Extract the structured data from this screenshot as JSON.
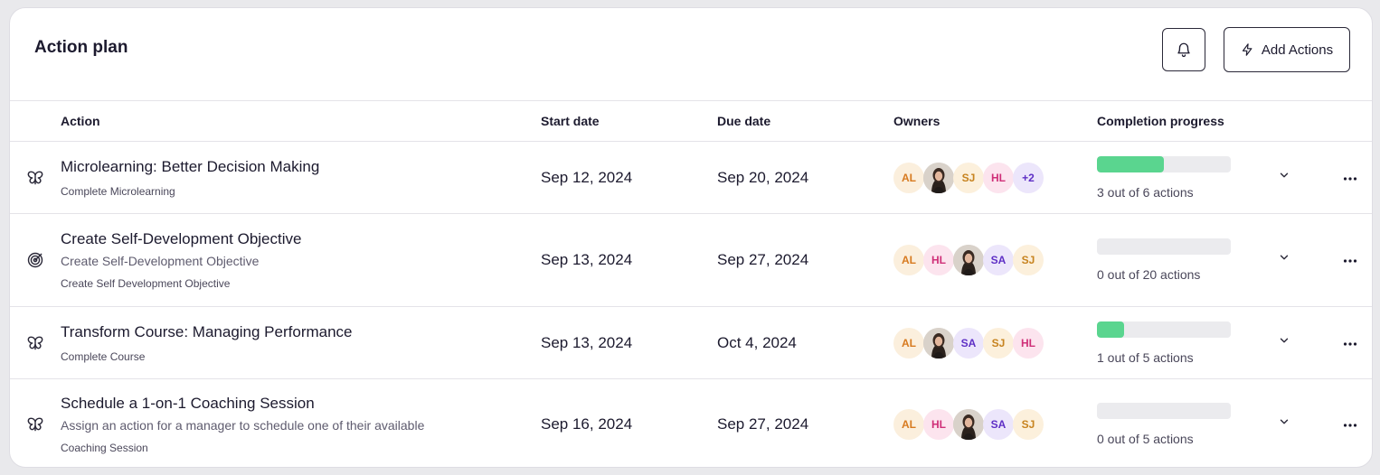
{
  "header": {
    "title": "Action plan",
    "add_label": "Add Actions"
  },
  "table": {
    "headers": {
      "action": "Action",
      "start": "Start date",
      "due": "Due date",
      "owners": "Owners",
      "progress": "Completion progress"
    },
    "rows": [
      {
        "icon": "butterfly-icon",
        "title": "Microlearning: Better Decision Making",
        "description": "",
        "tag": "Complete Microlearning",
        "start": "Sep 12, 2024",
        "due": "Sep 20, 2024",
        "owners": [
          "AL",
          "photo",
          "SJ",
          "HL",
          "+2"
        ],
        "progress_fraction": 0.5,
        "progress_text": "3 out of 6 actions"
      },
      {
        "icon": "target-icon",
        "title": "Create Self-Development Objective",
        "description": "Create Self-Development Objective",
        "tag": "Create Self Development Objective",
        "start": "Sep 13, 2024",
        "due": "Sep 27, 2024",
        "owners": [
          "AL",
          "HL",
          "photo",
          "SA",
          "SJ"
        ],
        "progress_fraction": 0,
        "progress_text": "0 out of 20 actions"
      },
      {
        "icon": "butterfly-icon",
        "title": "Transform Course: Managing Performance",
        "description": "",
        "tag": "Complete Course",
        "start": "Sep 13, 2024",
        "due": "Oct 4, 2024",
        "owners": [
          "AL",
          "photo",
          "SA",
          "SJ",
          "HL"
        ],
        "progress_fraction": 0.2,
        "progress_text": "1 out of 5 actions"
      },
      {
        "icon": "butterfly-icon",
        "title": "Schedule a 1-on-1 Coaching Session",
        "description": "Assign an action for a manager to schedule one of their available",
        "tag": "Coaching Session",
        "start": "Sep 16, 2024",
        "due": "Sep 27, 2024",
        "owners": [
          "AL",
          "HL",
          "photo",
          "SA",
          "SJ"
        ],
        "progress_fraction": 0,
        "progress_text": "0 out of 5 actions"
      }
    ]
  },
  "colors": {
    "progress_fill": "#5ad58f",
    "progress_track": "#ebebee",
    "text_primary": "#1c1a2e"
  }
}
